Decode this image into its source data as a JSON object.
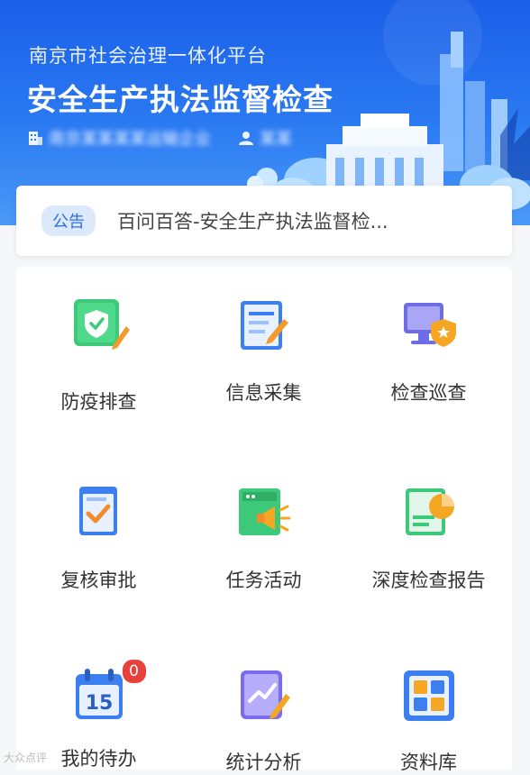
{
  "banner": {
    "subtitle": "南京市社会治理一体化平台",
    "title": "安全生产执法监督检查",
    "org": "南京某某某某运输企业",
    "user": "某某"
  },
  "notice": {
    "tag": "公告",
    "text": "百问百答-安全生产执法监督检..."
  },
  "grid": {
    "items": [
      {
        "label": "防疫排查",
        "icon": "shield-check-icon"
      },
      {
        "label": "信息采集",
        "icon": "document-edit-icon"
      },
      {
        "label": "检查巡查",
        "icon": "monitor-shield-icon"
      },
      {
        "label": "复核审批",
        "icon": "checklist-icon"
      },
      {
        "label": "任务活动",
        "icon": "megaphone-icon"
      },
      {
        "label": "深度检查报告",
        "icon": "report-chart-icon"
      },
      {
        "label": "我的待办",
        "icon": "calendar-icon",
        "badge": "0",
        "day": "15"
      },
      {
        "label": "统计分析",
        "icon": "stats-icon"
      },
      {
        "label": "资料库",
        "icon": "library-icon"
      }
    ]
  },
  "watermark": "大众点评"
}
